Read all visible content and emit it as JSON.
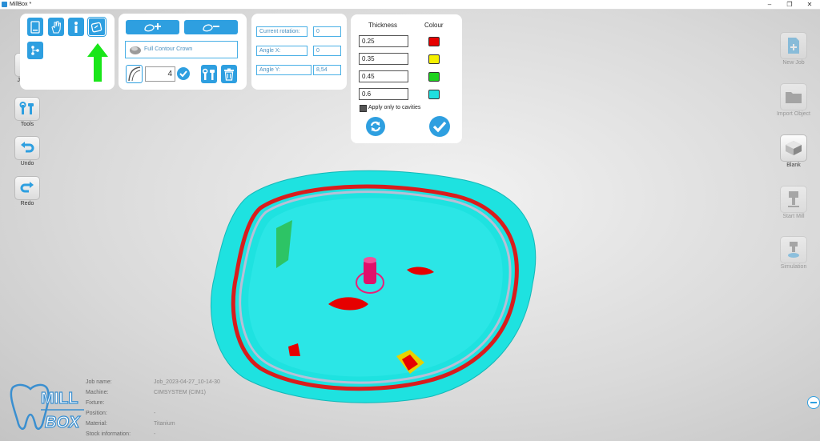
{
  "window": {
    "title": "MillBox *"
  },
  "left_toolbar": [
    {
      "label": "Job M...",
      "icon": "job-management-icon"
    },
    {
      "label": "Tools",
      "icon": "tools-icon"
    },
    {
      "label": "Undo",
      "icon": "undo-icon"
    },
    {
      "label": "Redo",
      "icon": "redo-icon"
    }
  ],
  "right_toolbar": [
    {
      "label": "New Job",
      "icon": "new-job-icon",
      "active": false
    },
    {
      "label": "Import Object",
      "icon": "import-object-icon",
      "active": false
    },
    {
      "label": "Blank",
      "icon": "blank-icon",
      "active": true
    },
    {
      "label": "Start Mill",
      "icon": "start-mill-icon",
      "active": false
    },
    {
      "label": "Simulation",
      "icon": "simulation-icon",
      "active": false
    }
  ],
  "object_panel": {
    "object_name": "Full Contour Crown",
    "quantity": "4"
  },
  "rotation_panel": {
    "current_rotation_label": "Current rotation:",
    "current_rotation_value": "0",
    "angle_x_label": "Angle X:",
    "angle_x_value": "0",
    "angle_y_label": "Angle Y:",
    "angle_y_value": "8,54"
  },
  "thickness_panel": {
    "thickness_header": "Thickness",
    "colour_header": "Colour",
    "rows": [
      {
        "value": "0.25",
        "color": "#e60000"
      },
      {
        "value": "0.35",
        "color": "#f5f000"
      },
      {
        "value": "0.45",
        "color": "#1ed21e"
      },
      {
        "value": "0.6",
        "color": "#1fe0e0"
      }
    ],
    "apply_label": "Apply only to cavities"
  },
  "job_info": {
    "rows": [
      {
        "label": "Job name:",
        "value": "Job_2023-04-27_10-14-30"
      },
      {
        "label": "Machine:",
        "value": "CIMSYSTEM (CIM1)"
      },
      {
        "label": "Fixture:",
        "value": ""
      },
      {
        "label": "Position:",
        "value": "-"
      },
      {
        "label": "Material:",
        "value": "Titanium"
      },
      {
        "label": "Stock information:",
        "value": "-"
      }
    ]
  },
  "logo": {
    "line1": "MILL",
    "line2": "BOX"
  },
  "colors": {
    "accent": "#2e9fe0",
    "model_cyan": "#1ee2e0",
    "arrow_green": "#19e619"
  }
}
